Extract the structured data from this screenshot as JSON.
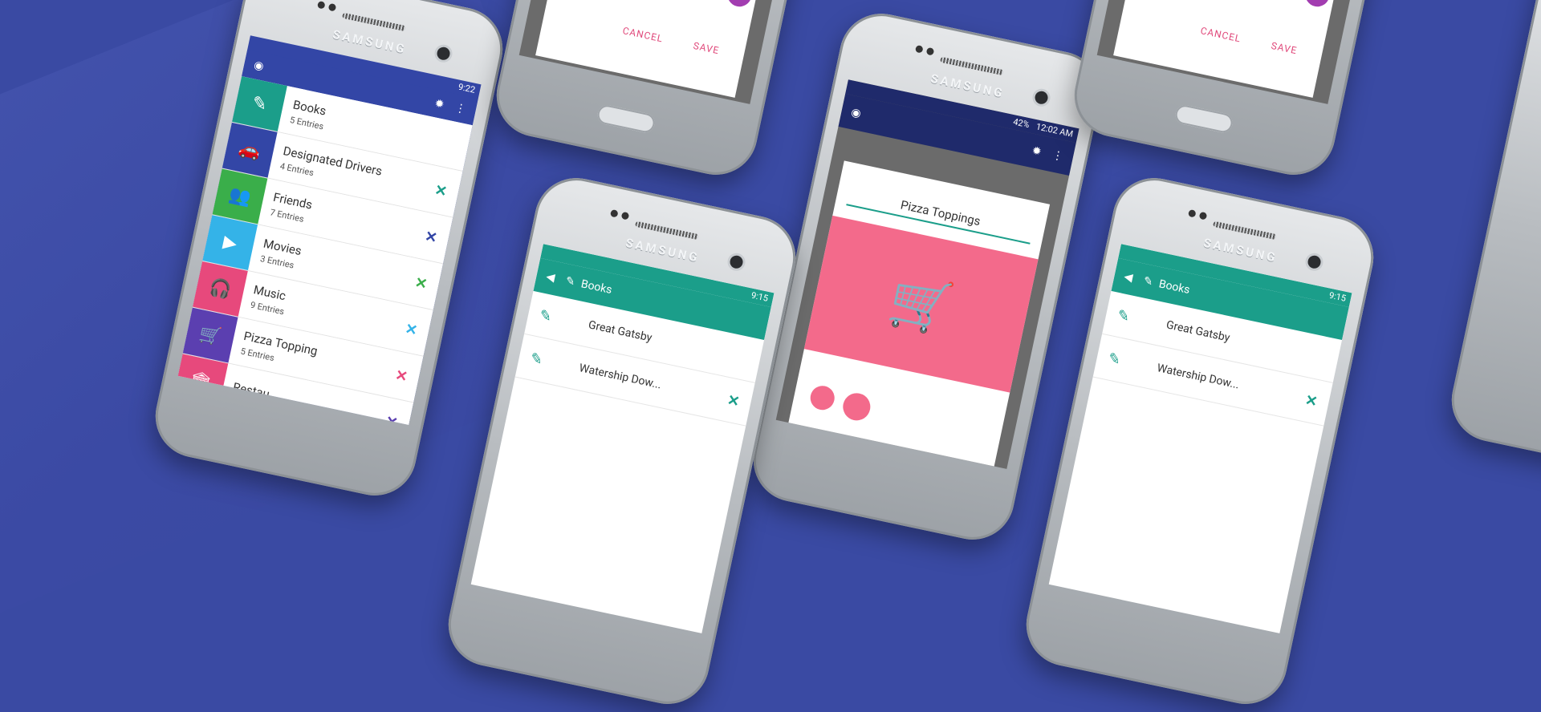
{
  "brand": "SAMSUNG",
  "colors": {
    "bg": "#3a4aa3",
    "teal": "#1b9e8a",
    "pink": "#f36a8b",
    "navy": "#2a3487"
  },
  "list_phone": {
    "time": "9:22",
    "items": [
      {
        "title": "Books",
        "sub": "5 Entries",
        "color": "#1b9e8a",
        "icon": "✎",
        "x": "",
        "xcolor": ""
      },
      {
        "title": "Designated Drivers",
        "sub": "4 Entries",
        "color": "#3346a6",
        "icon": "🚗",
        "x": "✕",
        "xcolor": "#1b9e8a"
      },
      {
        "title": "Friends",
        "sub": "7 Entries",
        "color": "#3aae4a",
        "icon": "👥",
        "x": "✕",
        "xcolor": "#3346a6"
      },
      {
        "title": "Movies",
        "sub": "3 Entries",
        "color": "#34b3e8",
        "icon": "▶",
        "x": "✕",
        "xcolor": "#3aae4a"
      },
      {
        "title": "Music",
        "sub": "9 Entries",
        "color": "#e7497c",
        "icon": "🎧",
        "x": "✕",
        "xcolor": "#34b3e8"
      },
      {
        "title": "Pizza Topping",
        "sub": "5 Entries",
        "color": "#5b3fb0",
        "icon": "🛒",
        "x": "✕",
        "xcolor": "#e7497c"
      },
      {
        "title": "Restau...",
        "sub": "",
        "color": "#e7497c",
        "icon": "🏛",
        "x": "✕",
        "xcolor": "#5b3fb0"
      }
    ]
  },
  "dialog_phone": {
    "cancel": "CANCEL",
    "save": "SAVE"
  },
  "center_phone": {
    "time": "12:02 AM",
    "battery": "42%",
    "title": "Pizza Toppings"
  },
  "books_phone": {
    "time": "9:15",
    "title": "Books",
    "rows": [
      "Great Gatsby",
      "Watership Dow..."
    ]
  }
}
